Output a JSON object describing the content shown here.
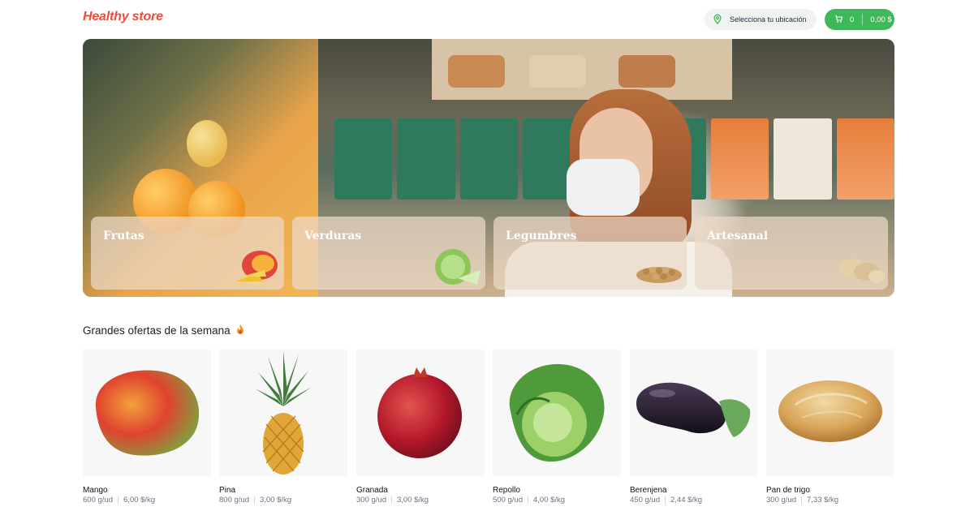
{
  "header": {
    "logo": "Healthy store",
    "location": "Selecciona tu ubicación",
    "cart_count": "0",
    "cart_total": "0,00 $"
  },
  "categories": [
    {
      "label": "Frutas"
    },
    {
      "label": "Verduras"
    },
    {
      "label": "Legumbres"
    },
    {
      "label": "Artesanal"
    }
  ],
  "offers": {
    "title": "Grandes ofertas de la semana",
    "products": [
      {
        "name": "Mango",
        "weight": "600 g/ud",
        "price": "6,00 $/kg"
      },
      {
        "name": "Pina",
        "weight": "800 g/ud",
        "price": "3,00 $/kg"
      },
      {
        "name": "Granada",
        "weight": "300 g/ud",
        "price": "3,00 $/kg"
      },
      {
        "name": "Repollo",
        "weight": "500 g/ud",
        "price": "4,00 $/kg"
      },
      {
        "name": "Berenjena",
        "weight": "450 g/ud",
        "price": "2,44 $/kg"
      },
      {
        "name": "Pan de trigo",
        "weight": "300 g/ud",
        "price": "7,33 $/kg"
      }
    ]
  },
  "colors": {
    "brand": "#ef4b3b",
    "accent_green": "#3fb85a"
  }
}
